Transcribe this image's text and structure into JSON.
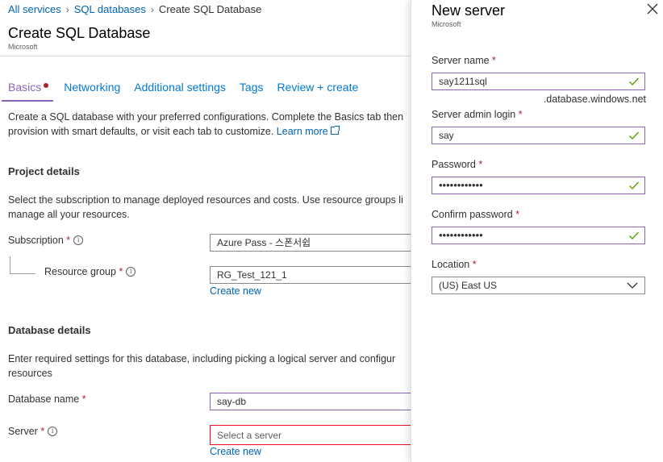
{
  "breadcrumb": {
    "items": [
      "All services",
      "SQL databases"
    ],
    "current": "Create SQL Database"
  },
  "header": {
    "title": "Create SQL Database",
    "publisher": "Microsoft"
  },
  "tabs": [
    {
      "label": "Basics",
      "active": true
    },
    {
      "label": "Networking"
    },
    {
      "label": "Additional settings"
    },
    {
      "label": "Tags"
    },
    {
      "label": "Review + create"
    }
  ],
  "intro": {
    "line1": "Create a SQL database with your preferred configurations. Complete the Basics tab then",
    "line2": "provision with smart defaults, or visit each tab to customize.",
    "learn_more": "Learn more"
  },
  "project": {
    "heading": "Project details",
    "desc1": "Select the subscription to manage deployed resources and costs. Use resource groups li",
    "desc2": "manage all your resources.",
    "subscription_label": "Subscription",
    "subscription_value": "Azure Pass - 스폰서쉽",
    "resource_group_label": "Resource group",
    "resource_group_value": "RG_Test_121_1",
    "create_new": "Create new"
  },
  "database": {
    "heading": "Database details",
    "desc1": "Enter required settings for this database, including picking a logical server and configur",
    "desc2": "resources",
    "name_label": "Database name",
    "name_value": "say-db",
    "server_label": "Server",
    "server_placeholder": "Select a server",
    "create_new": "Create new"
  },
  "required_mark": "*",
  "info_glyph": "i",
  "panel": {
    "title": "New server",
    "publisher": "Microsoft",
    "server_name_label": "Server name",
    "server_name_value": "say1211sql",
    "suffix": ".database.windows.net",
    "admin_label": "Server admin login",
    "admin_value": "say",
    "password_label": "Password",
    "password_value": "••••••••••••",
    "confirm_label": "Confirm password",
    "confirm_value": "••••••••••••",
    "location_label": "Location",
    "location_value": "(US) East US"
  },
  "colors": {
    "accent_purple": "#8764b8",
    "link_blue": "#0063b1",
    "error_red": "#e81123",
    "success_green": "#57a300",
    "required_red": "#a4262c"
  }
}
